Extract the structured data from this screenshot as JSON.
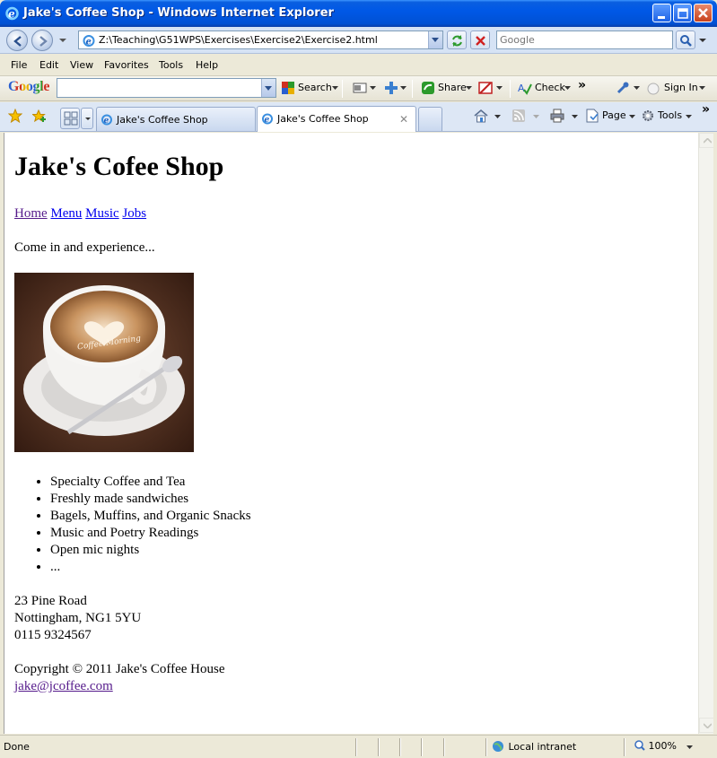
{
  "window": {
    "title": "Jake's Coffee Shop - Windows Internet Explorer"
  },
  "address_bar": {
    "url": "Z:\\Teaching\\G51WPS\\Exercises\\Exercise2\\Exercise2.html"
  },
  "search": {
    "placeholder": "Google"
  },
  "menu": [
    "File",
    "Edit",
    "View",
    "Favorites",
    "Tools",
    "Help"
  ],
  "google_toolbar": {
    "logo": "Google",
    "search_label": "Search",
    "share_label": "Share",
    "check_label": "Check",
    "more_label": "»",
    "sign_in_label": "Sign In"
  },
  "tabs": [
    {
      "label": "Jake's Coffee Shop",
      "active": false
    },
    {
      "label": "Jake's Coffee Shop",
      "active": true
    }
  ],
  "command_bar": {
    "page_label": "Page",
    "tools_label": "Tools",
    "more_label": "»"
  },
  "page": {
    "heading": "Jake's Cofee Shop",
    "nav": [
      "Home",
      "Menu",
      "Music",
      "Jobs"
    ],
    "intro": "Come in and experience...",
    "image_caption": "Coffee Morning",
    "features": [
      "Specialty Coffee and Tea",
      "Freshly made sandwiches",
      "Bagels, Muffins, and Organic Snacks",
      "Music and Poetry Readings",
      "Open mic nights",
      "..."
    ],
    "address_lines": [
      "23 Pine Road",
      "Nottingham, NG1 5YU",
      "0115 9324567"
    ],
    "copyright": "Copyright © 2011 Jake's Coffee House",
    "email": "jake@jcoffee.com"
  },
  "status": {
    "text": "Done",
    "zone": "Local intranet",
    "zoom": "100%"
  },
  "colors": {
    "titlebar": "#0058e6",
    "link": "#0000ee",
    "visited_link": "#551a8b"
  },
  "icons": [
    "ie-icon",
    "minimize-icon",
    "maximize-icon",
    "close-icon",
    "back-icon",
    "forward-icon",
    "refresh-icon",
    "stop-icon",
    "search-icon",
    "favorites-star-icon",
    "add-favorite-icon",
    "quick-tabs-icon",
    "home-icon",
    "feeds-icon",
    "print-icon",
    "page-icon",
    "tools-gear-icon",
    "wrench-icon",
    "intranet-globe-icon",
    "zoom-icon"
  ]
}
